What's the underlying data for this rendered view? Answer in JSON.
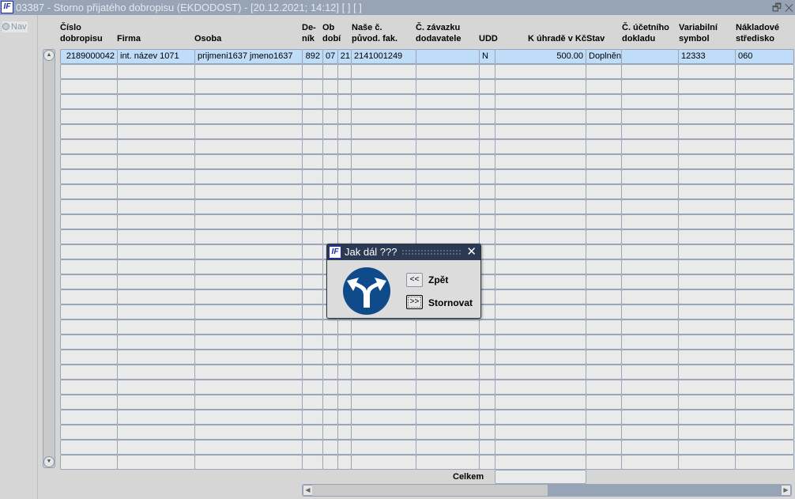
{
  "window": {
    "title": "03387 - Storno přijatého dobropisu (EKDODOST) - [20.12.2021; 14:12]  [ ]  [ ]",
    "logo": "IF",
    "restore_icon": "restore-icon",
    "close_icon": "close-icon"
  },
  "nav": {
    "label": "Nav"
  },
  "columns": [
    {
      "label": "Číslo\ndobropisu"
    },
    {
      "label": "Firma"
    },
    {
      "label": "Osoba"
    },
    {
      "label": "De-\nník"
    },
    {
      "label": "Ob\ndobí"
    },
    {
      "label": ""
    },
    {
      "label": "Naše č.\npůvod. fak."
    },
    {
      "label": "Č. závazku\ndodavatele"
    },
    {
      "label": "UDD"
    },
    {
      "label": "K úhradě v Kč"
    },
    {
      "label": "Stav"
    },
    {
      "label": "Č. účetního\ndokladu"
    },
    {
      "label": "Variabilní\nsymbol"
    },
    {
      "label": "Nákladové\nstředisko"
    }
  ],
  "rows": [
    [
      "2189000042",
      "int. název 1071",
      "prijmeni1637 jmeno1637",
      "892",
      "07",
      "21",
      "2141001249",
      "",
      "N",
      "500.00",
      "Doplněn",
      "",
      "12333",
      "060"
    ]
  ],
  "footer": {
    "total_label": "Celkem",
    "total_value": ""
  },
  "dialog": {
    "title": "Jak dál ???",
    "logo": "IF",
    "icon": "fork-arrows-sign-icon",
    "sign_color": "#0f4a8a",
    "buttons": [
      {
        "symbol": "<<",
        "label": "Zpět"
      },
      {
        "symbol": ">>",
        "label": "Stornovat"
      }
    ]
  }
}
